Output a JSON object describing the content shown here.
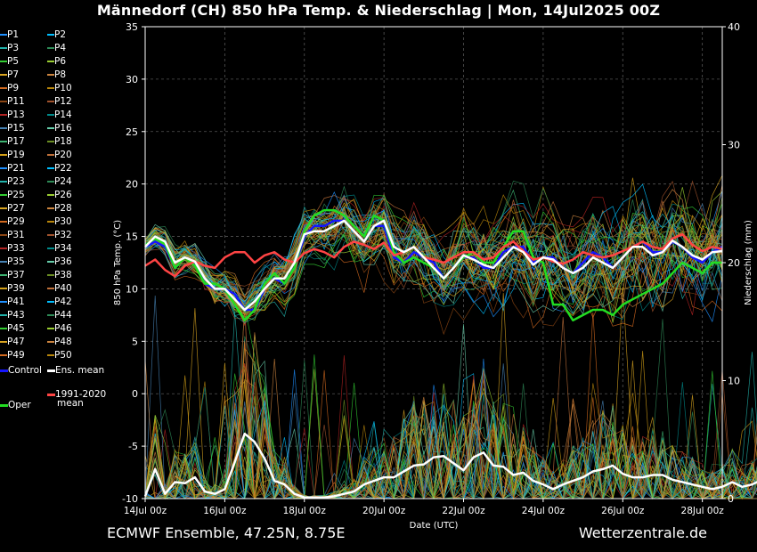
{
  "title": "Männedorf  (CH)  850 hPa Temp. & Niederschlag | Mon, 14Jul2025 00Z",
  "footer_left": "ECMWF Ensemble, 47.25N, 8.75E",
  "footer_right": "Wetterzentrale.de",
  "colors": {
    "control": "#1515ff",
    "mean": "#ffffff",
    "oper": "#22dd22",
    "clim": "#ff4444"
  },
  "legend": {
    "members": [
      "P1",
      "P2",
      "P3",
      "P4",
      "P5",
      "P6",
      "P7",
      "P8",
      "P9",
      "P10",
      "P11",
      "P12",
      "P13",
      "P14",
      "P15",
      "P16",
      "P17",
      "P18",
      "P19",
      "P20",
      "P21",
      "P22",
      "P23",
      "P24",
      "P25",
      "P26",
      "P27",
      "P28",
      "P29",
      "P30",
      "P31",
      "P32",
      "P33",
      "P34",
      "P35",
      "P36",
      "P37",
      "P38",
      "P39",
      "P40",
      "P41",
      "P42",
      "P43",
      "P44",
      "P45",
      "P46",
      "P47",
      "P48",
      "P49",
      "P50"
    ],
    "control": "Control",
    "mean": "Ens. mean",
    "clim_line1": "1991-2020",
    "clim_line2": "mean",
    "oper": "Oper"
  },
  "chart_data": {
    "type": "line",
    "xlabel": "Date (UTC)",
    "ylabel": "850 hPa Temp. (°C)",
    "y2label": "Niederschlag (mm)",
    "ylim": [
      -10,
      35
    ],
    "y2lim": [
      0,
      40
    ],
    "x_range": [
      "14Jul 00z",
      "28Jul 12z"
    ],
    "x_step_hours": 6,
    "x_ticks": [
      "14Jul 00z",
      "16Jul 00z",
      "18Jul 00z",
      "20Jul 00z",
      "22Jul 00z",
      "24Jul 00z",
      "26Jul 00z",
      "28Jul 00z"
    ],
    "y_ticks": [
      -10,
      -5,
      0,
      5,
      10,
      15,
      20,
      25,
      30,
      35
    ],
    "y2_ticks": [
      0,
      10,
      20,
      30,
      40
    ],
    "grid": true,
    "series": [
      {
        "name": "Ens. mean",
        "axis": "temp",
        "values": [
          14,
          15,
          14.5,
          12.5,
          13,
          12.6,
          11,
          10,
          10,
          9,
          8,
          8.8,
          10,
          11,
          11,
          12.5,
          15.2,
          15.5,
          15.5,
          16,
          16.5,
          15.5,
          14.5,
          16,
          16.5,
          14,
          13.5,
          14,
          13,
          12,
          11,
          12,
          13.2,
          12.8,
          12.3,
          12,
          13,
          14,
          13.5,
          12.3,
          13,
          12.8,
          12,
          11.5,
          12,
          13,
          12.5,
          12,
          13,
          14,
          14,
          13.2,
          13.5,
          14.6,
          14,
          13.2,
          12.8,
          13.5,
          13.6
        ]
      },
      {
        "name": "Control",
        "axis": "temp",
        "values": [
          14,
          14.5,
          14,
          12,
          13,
          12.5,
          10.5,
          10,
          10,
          9.5,
          8,
          8,
          10,
          11,
          10.5,
          12,
          15,
          16,
          16,
          16.5,
          16.5,
          15.5,
          14.5,
          16,
          16,
          13,
          12.5,
          13.5,
          13,
          12.5,
          11,
          12,
          13,
          13,
          12,
          12,
          13.5,
          14,
          14,
          12.5,
          13,
          13,
          12,
          11.5,
          12.5,
          13.5,
          13,
          12,
          13,
          14,
          14.5,
          13.5,
          13.5,
          14.5,
          14,
          13,
          12.5,
          13.5,
          14
        ]
      },
      {
        "name": "Oper",
        "axis": "temp",
        "values": [
          14.2,
          14.8,
          14.3,
          12,
          13,
          12.2,
          10.5,
          10.5,
          10,
          8.5,
          7,
          8,
          10.5,
          11.5,
          10.5,
          12,
          15.5,
          17,
          17.5,
          17.5,
          17,
          16,
          15,
          17,
          16.5,
          13.5,
          12.5,
          13,
          12.5,
          12,
          11,
          12,
          13,
          13.5,
          12.5,
          12.5,
          14,
          15.5,
          15.5,
          13,
          12.5,
          8.5,
          8.5,
          7,
          7.5,
          8,
          8,
          7.5,
          8.5,
          9,
          9.5,
          10,
          10.5,
          11.5,
          12.5,
          12,
          11.5,
          12.5,
          12.5
        ]
      },
      {
        "name": "1991-2020 mean",
        "axis": "temp",
        "values": [
          12.2,
          12.8,
          11.8,
          11.2,
          12.2,
          12.6,
          12.2,
          12,
          13,
          13.5,
          13.5,
          12.5,
          13.2,
          13.5,
          12.8,
          12.5,
          13.4,
          13.8,
          13.5,
          13,
          14,
          14.5,
          14.2,
          13.8,
          14.4,
          13.2,
          13.5,
          14,
          13,
          12.8,
          12.5,
          13,
          13.5,
          13.5,
          12.8,
          13,
          14,
          14.5,
          13.6,
          12.8,
          13,
          12.6,
          12.4,
          12.8,
          13.5,
          13.2,
          13,
          13.2,
          13.6,
          14,
          14.5,
          14,
          13.8,
          14.8,
          15.2,
          14.2,
          13.6,
          14,
          13.8
        ]
      },
      {
        "name": "Ens. mean precip",
        "axis": "precip",
        "values": [
          0.2,
          2.5,
          0.4,
          1.4,
          1.3,
          1.8,
          0.6,
          0.4,
          0.8,
          3.1,
          5.5,
          4.8,
          3.4,
          1.5,
          1.2,
          0.4,
          0.1,
          0.1,
          0.1,
          0.2,
          0.4,
          0.6,
          1.2,
          1.5,
          1.8,
          1.8,
          2.3,
          2.8,
          2.9,
          3.5,
          3.6,
          3.0,
          2.4,
          3.5,
          3.9,
          2.8,
          2.7,
          2.0,
          2.2,
          1.5,
          1.2,
          0.8,
          1.2,
          1.5,
          1.8,
          2.3,
          2.5,
          2.8,
          2.1,
          1.8,
          1.8,
          2.0,
          2.0,
          1.6,
          1.4,
          1.2,
          1.0,
          0.8,
          1.0,
          1.4,
          1.0,
          1.2,
          1.6,
          1.2,
          0.7,
          1.0,
          0.4,
          0.9,
          1.1,
          1.3,
          0.6
        ]
      }
    ]
  }
}
